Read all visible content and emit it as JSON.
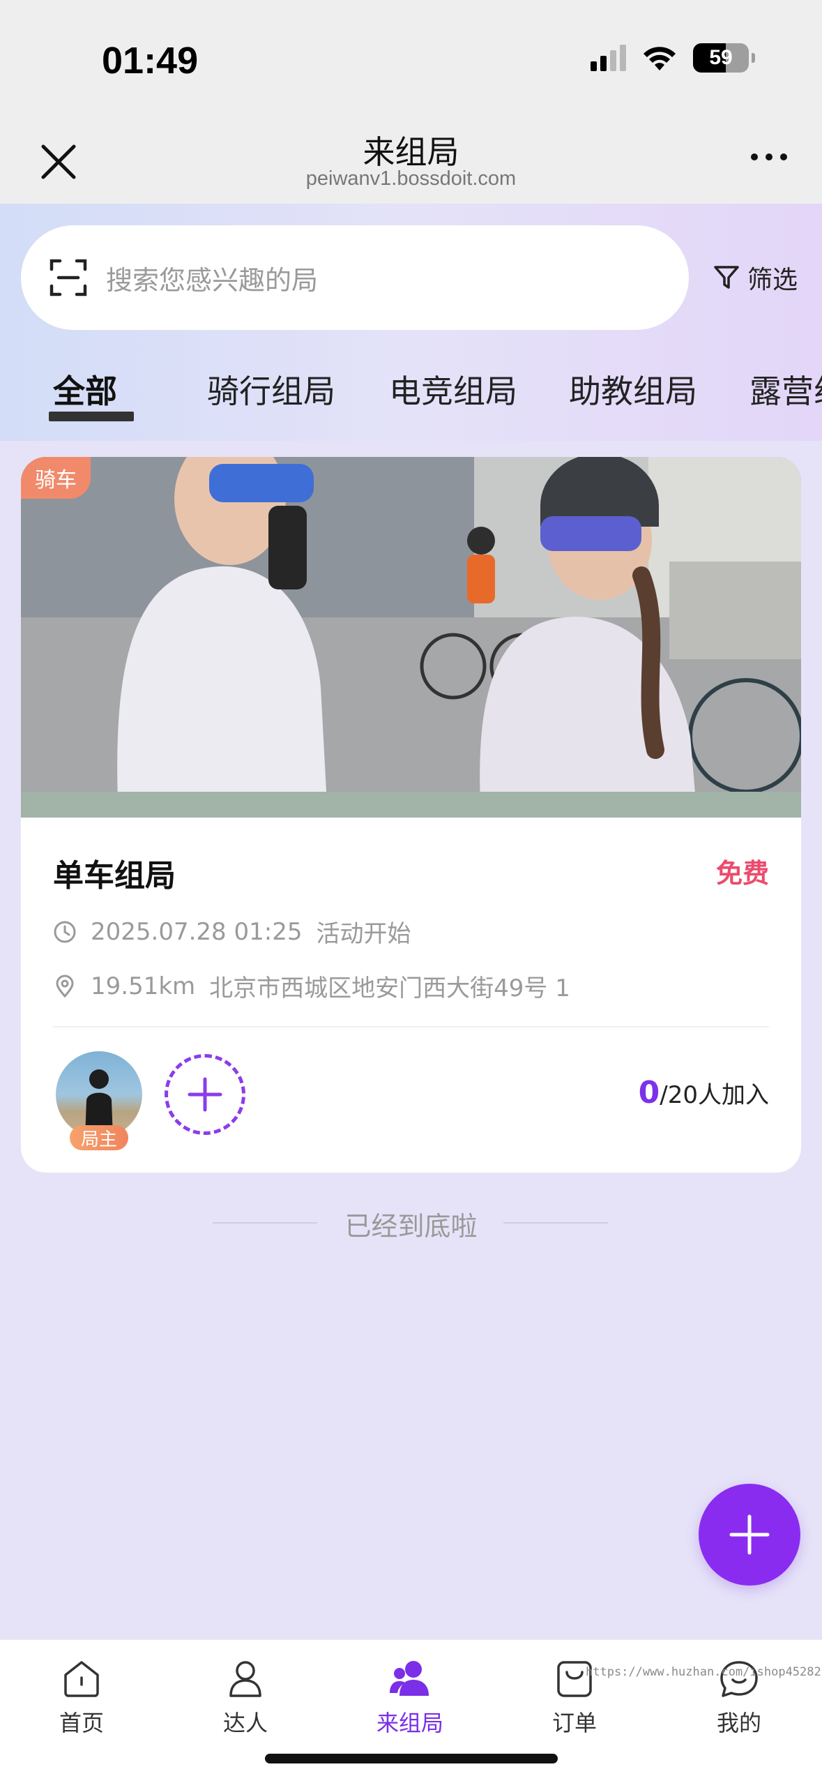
{
  "status_bar": {
    "time": "01:49",
    "battery": "59"
  },
  "nav": {
    "title": "来组局",
    "url": "peiwanv1.bossdoit.com"
  },
  "search": {
    "placeholder": "搜索您感兴趣的局",
    "filter_label": "筛选"
  },
  "tabs": [
    {
      "label": "全部",
      "active": true
    },
    {
      "label": "骑行组局",
      "active": false
    },
    {
      "label": "电竞组局",
      "active": false
    },
    {
      "label": "助教组局",
      "active": false
    },
    {
      "label": "露营组局",
      "active": false
    }
  ],
  "card": {
    "tag": "骑车",
    "title": "单车组局",
    "price": "免费",
    "time": "2025.07.28 01:25",
    "time_suffix": "活动开始",
    "distance": "19.51km",
    "address": "北京市西城区地安门西大街49号 1",
    "host_badge": "局主",
    "joined": "0",
    "capacity_text": "/20人加入"
  },
  "list_end_text": "已经到底啦",
  "bottom_nav": [
    {
      "label": "首页",
      "icon": "home-icon",
      "active": false
    },
    {
      "label": "达人",
      "icon": "person-icon",
      "active": false
    },
    {
      "label": "来组局",
      "icon": "group-icon",
      "active": true
    },
    {
      "label": "订单",
      "icon": "bag-icon",
      "active": false
    },
    {
      "label": "我的",
      "icon": "chat-bubble-icon",
      "active": false
    }
  ],
  "watermark": "https://www.huzhan.com/ishop45282",
  "colors": {
    "accent": "#7b2fe6",
    "price": "#ea4c6e",
    "tag": "#f08a6a"
  }
}
